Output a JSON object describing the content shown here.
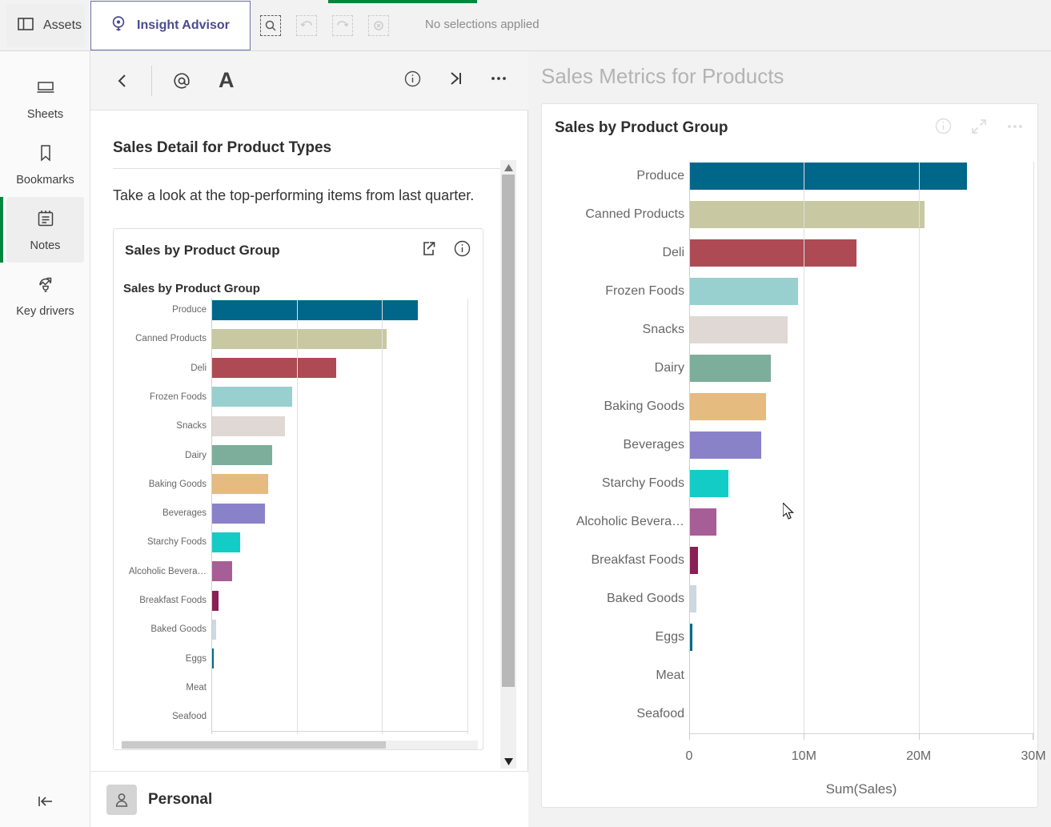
{
  "topbar": {
    "assets_label": "Assets",
    "insight_advisor_label": "Insight Advisor",
    "selections_text": "No selections applied",
    "icons": {
      "assets_panel": "panel-icon",
      "insight_advisor": "lightbulb-icon",
      "smart_search": "smart-search-icon",
      "step_back": "undo-icon",
      "step_forward": "redo-icon",
      "clear_selections": "clear-selections-icon"
    },
    "progress_color": "#00873d"
  },
  "sidebar": {
    "items": [
      {
        "label": "Sheets",
        "icon": "sheets-icon",
        "active": false
      },
      {
        "label": "Bookmarks",
        "icon": "bookmark-icon",
        "active": false
      },
      {
        "label": "Notes",
        "icon": "notes-icon",
        "active": true
      },
      {
        "label": "Key drivers",
        "icon": "key-drivers-icon",
        "active": false
      }
    ],
    "collapse_icon": "collapse-left-icon",
    "active_indicator_color": "#00873d"
  },
  "note_panel": {
    "toolbar": {
      "back_icon": "chevron-left-icon",
      "mention_icon": "at-mention-icon",
      "text_format_label": "A",
      "info_icon": "info-icon",
      "expand_icon": "collapse-right-icon",
      "more_icon": "more-options-icon"
    },
    "title": "Sales Detail for Product Types",
    "body_text": "Take a look at the top-performing items from last quarter.",
    "embedded_card": {
      "title": "Sales by Product Group",
      "share_icon": "share-icon",
      "info_icon": "info-icon",
      "chart_title": "Sales by Product Group"
    },
    "footer": {
      "avatar_icon": "user-avatar-icon",
      "label": "Personal"
    }
  },
  "right_pane": {
    "title": "Sales Metrics for Products",
    "card": {
      "title": "Sales by Product Group",
      "info_icon": "info-icon",
      "fullscreen_icon": "expand-icon",
      "more_icon": "more-options-icon"
    }
  },
  "chart_data": {
    "type": "bar",
    "orientation": "horizontal",
    "title": "Sales by Product Group",
    "xlabel": "Sum(Sales)",
    "ylabel": "",
    "xlim": [
      0,
      30000000
    ],
    "xticks": [
      0,
      10000000,
      20000000,
      30000000
    ],
    "xtick_labels": [
      "0",
      "10M",
      "20M",
      "30M"
    ],
    "grid": true,
    "legend": "none",
    "categories": [
      "Produce",
      "Canned Products",
      "Deli",
      "Frozen Foods",
      "Snacks",
      "Dairy",
      "Baking Goods",
      "Beverages",
      "Starchy Foods",
      "Alcoholic Bevera…",
      "Breakfast Foods",
      "Baked Goods",
      "Eggs",
      "Meat",
      "Seafood"
    ],
    "values": [
      24200000,
      20500000,
      14600000,
      9500000,
      8600000,
      7100000,
      6700000,
      6300000,
      3400000,
      2400000,
      800000,
      600000,
      300000,
      60000,
      50000
    ],
    "colors": [
      "#00668a",
      "#c8c8a2",
      "#ae4a54",
      "#97d0cf",
      "#e0d8d4",
      "#7cae9b",
      "#e5bb7f",
      "#8a82c8",
      "#14ccc6",
      "#a75e96",
      "#8a1f55",
      "#cdd8e0",
      "#046a87",
      "#cfd0b1",
      "#d69b9b"
    ]
  }
}
